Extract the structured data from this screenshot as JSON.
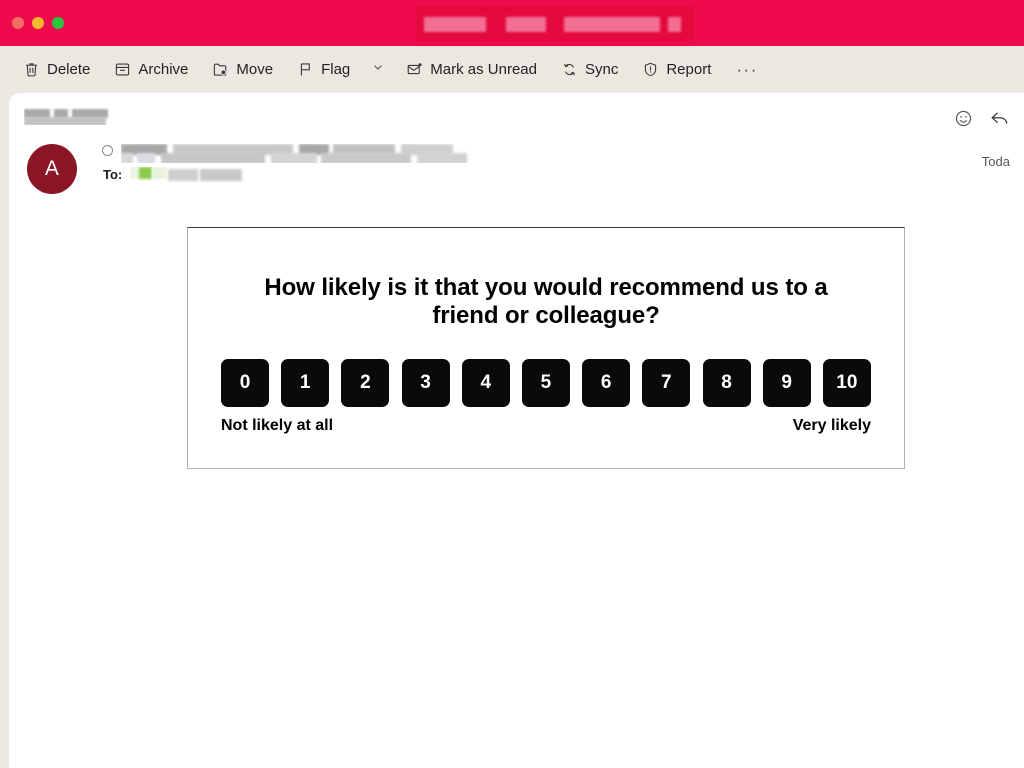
{
  "window": {
    "titlebar_color": "#ef0a4e",
    "traffic_lights": [
      "close",
      "minimize",
      "maximize"
    ],
    "title_redacted": true
  },
  "toolbar": {
    "items": [
      {
        "id": "delete",
        "label": "Delete",
        "icon": "trash-icon"
      },
      {
        "id": "archive",
        "label": "Archive",
        "icon": "archive-box-icon"
      },
      {
        "id": "move",
        "label": "Move",
        "icon": "folder-move-icon"
      },
      {
        "id": "flag",
        "label": "Flag",
        "icon": "flag-icon"
      },
      {
        "id": "mark-as-unread",
        "label": "Mark as Unread",
        "icon": "envelope-unread-icon"
      },
      {
        "id": "sync",
        "label": "Sync",
        "icon": "sync-icon"
      },
      {
        "id": "report",
        "label": "Report",
        "icon": "shield-alert-icon"
      }
    ],
    "flag_dropdown_icon": "chevron-down-icon",
    "overflow_label": "···"
  },
  "mail": {
    "subject_redacted": true,
    "avatar_initial": "A",
    "avatar_color": "#8b1726",
    "sender_redacted": true,
    "to_label": "To:",
    "to_redacted": true,
    "date": "Toda",
    "actions": [
      {
        "id": "reactions",
        "icon": "smiley-icon"
      },
      {
        "id": "reply",
        "icon": "reply-arrow-icon"
      }
    ]
  },
  "survey": {
    "title": "How likely is it that you would recommend us to a friend or colleague?",
    "scale": [
      "0",
      "1",
      "2",
      "3",
      "4",
      "5",
      "6",
      "7",
      "8",
      "9",
      "10"
    ],
    "low_label": "Not likely at all",
    "high_label": "Very likely",
    "button_color": "#0a0a0a",
    "button_text_color": "#ffffff"
  }
}
